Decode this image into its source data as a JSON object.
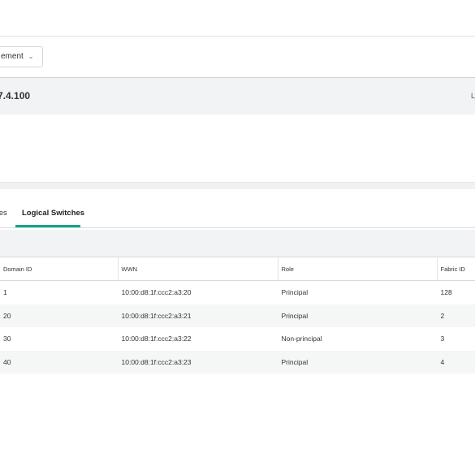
{
  "header": {
    "dropdown_label": "ement",
    "ip_address": "7.4.100",
    "right_fragment": "L"
  },
  "tabs": [
    {
      "label": "ses"
    },
    {
      "label": "Logical Switches",
      "active": true
    }
  ],
  "table": {
    "columns": [
      "Domain ID",
      "WWN",
      "Role",
      "Fabric ID"
    ],
    "rows": [
      [
        "1",
        "10:00:d8:1f:ccc2:a3:20",
        "Principal",
        "128"
      ],
      [
        "20",
        "10:00:d8:1f:ccc2:a3:21",
        "Principal",
        "2"
      ],
      [
        "30",
        "10:00:d8:1f:ccc2:a3:22",
        "Non-principal",
        "3"
      ],
      [
        "40",
        "10:00:d8:1f:ccc2:a3:23",
        "Principal",
        "4"
      ]
    ]
  },
  "colors": {
    "accent": "#01a982",
    "band": "#f2f3f4"
  }
}
